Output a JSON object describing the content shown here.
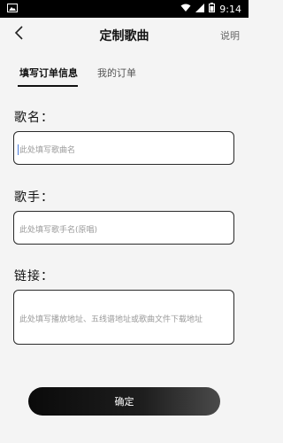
{
  "status_bar": {
    "time": "9:14"
  },
  "app_bar": {
    "title": "定制歌曲",
    "help": "说明"
  },
  "tabs": [
    {
      "label": "填写订单信息",
      "active": true
    },
    {
      "label": "我的订单",
      "active": false
    }
  ],
  "form": {
    "song_name": {
      "label": "歌名：",
      "value": "",
      "placeholder": "此处填写歌曲名"
    },
    "singer": {
      "label": "歌手：",
      "value": "",
      "placeholder": "此处填写歌手名(原唱)"
    },
    "link": {
      "label": "链接：",
      "value": "",
      "placeholder": "此处填写播放地址、五线谱地址或歌曲文件下载地址"
    }
  },
  "confirm_button": "确定",
  "colors": {
    "background": "#f4f4f4",
    "accent": "#111111",
    "caret": "#4a7bd8"
  }
}
